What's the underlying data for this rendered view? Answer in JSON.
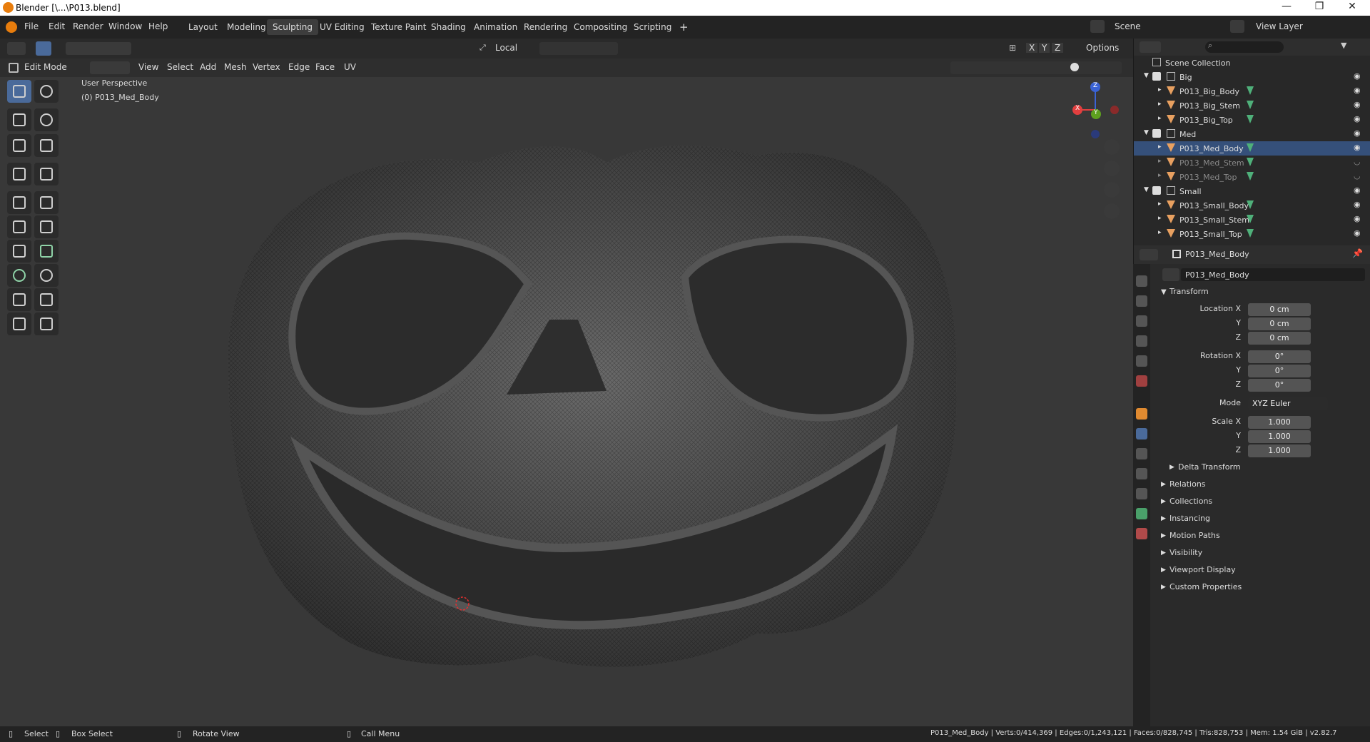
{
  "window": {
    "title": "Blender [\\...\\P013.blend]",
    "minimize": "—",
    "maximize": "❐",
    "close": "✕"
  },
  "menu": {
    "items": [
      "File",
      "Edit",
      "Render",
      "Window",
      "Help"
    ]
  },
  "workspaces": {
    "tabs": [
      "Layout",
      "Modeling",
      "Sculpting",
      "UV Editing",
      "Texture Paint",
      "Shading",
      "Animation",
      "Rendering",
      "Compositing",
      "Scripting"
    ],
    "active": "Sculpting",
    "add": "+"
  },
  "topright": {
    "scene": "Scene",
    "viewlayer": "View Layer"
  },
  "toolheader": {
    "orientation": "Local",
    "axes": [
      "X",
      "Y",
      "Z"
    ],
    "options": "Options"
  },
  "viewport_header": {
    "mode": "Edit Mode",
    "menus": [
      "View",
      "Select",
      "Add",
      "Mesh",
      "Vertex",
      "Edge",
      "Face",
      "UV"
    ]
  },
  "viewport": {
    "perspective": "User Perspective",
    "object": "(0) P013_Med_Body"
  },
  "gizmo": {
    "x": "X",
    "y": "Y",
    "z": "Z"
  },
  "outliner": {
    "root": "Scene Collection",
    "rows": [
      {
        "label": "Big",
        "type": "collection"
      },
      {
        "label": "P013_Big_Body",
        "type": "mesh"
      },
      {
        "label": "P013_Big_Stem",
        "type": "mesh"
      },
      {
        "label": "P013_Big_Top",
        "type": "mesh"
      },
      {
        "label": "Med",
        "type": "collection"
      },
      {
        "label": "P013_Med_Body",
        "type": "mesh",
        "selected": true
      },
      {
        "label": "P013_Med_Stem",
        "type": "mesh",
        "dim": true
      },
      {
        "label": "P013_Med_Top",
        "type": "mesh",
        "dim": true
      },
      {
        "label": "Small",
        "type": "collection"
      },
      {
        "label": "P013_Small_Body",
        "type": "mesh"
      },
      {
        "label": "P013_Small_Stem",
        "type": "mesh"
      },
      {
        "label": "P013_Small_Top",
        "type": "mesh"
      }
    ]
  },
  "properties": {
    "object": "P013_Med_Body",
    "name_field": "P013_Med_Body",
    "transform": {
      "title": "Transform",
      "location_label": "Location X",
      "loc_x": "0 cm",
      "loc_y": "0 cm",
      "loc_z": "0 cm",
      "rotation_label": "Rotation X",
      "rot_x": "0°",
      "rot_y": "0°",
      "rot_z": "0°",
      "mode_label": "Mode",
      "mode": "XYZ Euler",
      "scale_label": "Scale X",
      "scale_x": "1.000",
      "scale_y": "1.000",
      "scale_z": "1.000",
      "y": "Y",
      "z": "Z"
    },
    "delta": "Delta Transform",
    "sections": [
      "Relations",
      "Collections",
      "Instancing",
      "Motion Paths",
      "Visibility",
      "Viewport Display",
      "Custom Properties"
    ]
  },
  "statusbar": {
    "select": "Select",
    "box_select": "Box Select",
    "rotate": "Rotate View",
    "call_menu": "Call Menu",
    "stats": "P013_Med_Body | Verts:0/414,369 | Edges:0/1,243,121 | Faces:0/828,745 | Tris:828,753 | Mem: 1.54 GiB | v2.82.7"
  },
  "colors": {
    "accent": "#4772b3",
    "selected_row": "#35507a",
    "x_axis": "#e23f3f",
    "y_axis": "#5ea11f",
    "z_axis": "#3a63d5",
    "mesh_icon": "#e8a060"
  }
}
